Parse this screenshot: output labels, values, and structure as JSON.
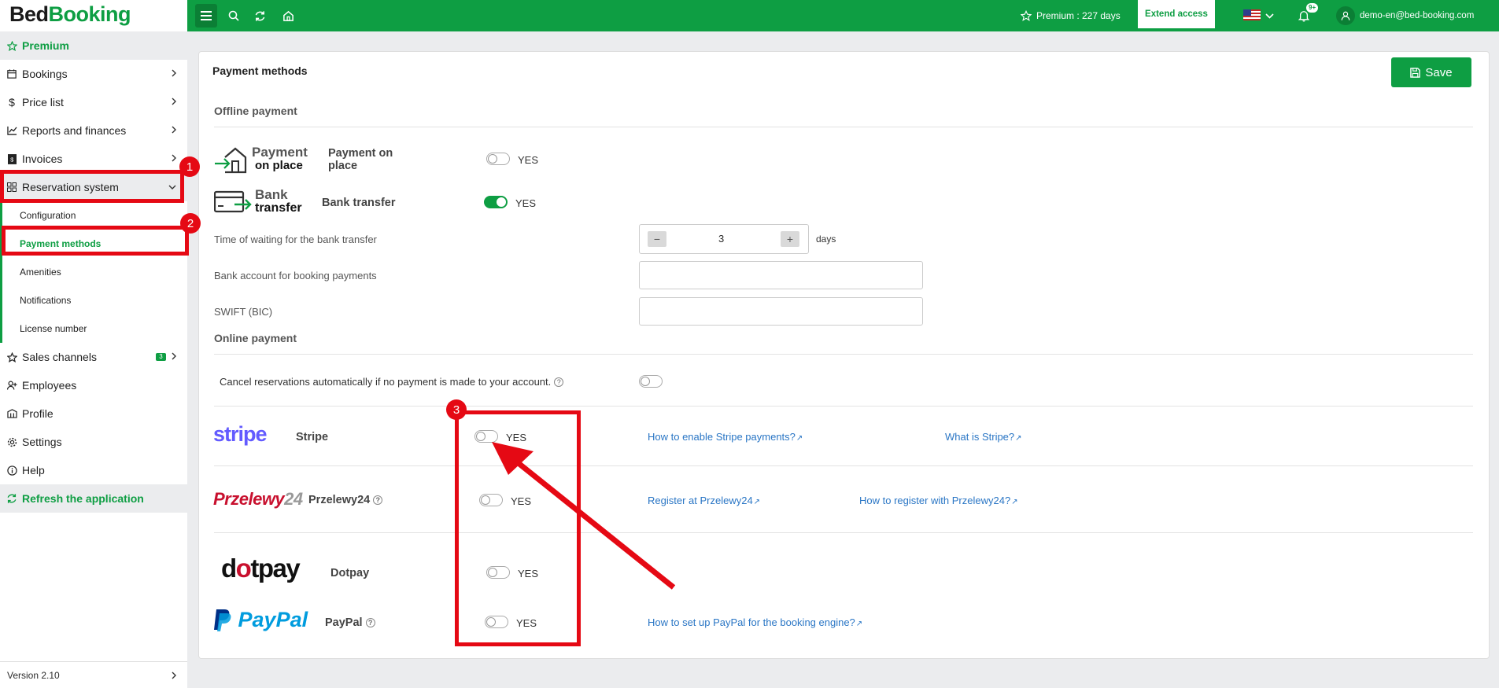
{
  "topbar": {
    "brand_a": "Bed",
    "brand_b": "Booking",
    "premium_text": "Premium : 227 days",
    "extend_label": "Extend access",
    "notifications_badge": "9+",
    "user_email": "demo-en@bed-booking.com"
  },
  "sidebar": {
    "premium": "Premium",
    "bookings": "Bookings",
    "price_list": "Price list",
    "reports": "Reports and finances",
    "invoices": "Invoices",
    "reservation_system": "Reservation system",
    "sub": {
      "configuration": "Configuration",
      "payment_methods": "Payment methods",
      "amenities": "Amenities",
      "notifications": "Notifications",
      "license": "License number"
    },
    "sales_channels": "Sales channels",
    "sales_badge": "3",
    "employees": "Employees",
    "profile": "Profile",
    "settings": "Settings",
    "help": "Help",
    "refresh": "Refresh the application",
    "version": "Version 2.10"
  },
  "main": {
    "title": "Payment methods",
    "save_label": "Save",
    "offline_title": "Offline payment",
    "online_title": "Online payment",
    "place_logo_a": "Payment",
    "place_logo_b": "on place",
    "place_label": "Payment on place",
    "bank_logo_a": "Bank",
    "bank_logo_b": "transfer",
    "bank_label": "Bank transfer",
    "yes": "YES",
    "waiting_label": "Time of waiting for the bank transfer",
    "waiting_value": "3",
    "days": "days",
    "bank_account_label": "Bank account for booking payments",
    "swift_label": "SWIFT (BIC)",
    "cancel_label": "Cancel reservations automatically if no payment is made to your account.",
    "stripe_logo": "stripe",
    "stripe_label": "Stripe",
    "stripe_link1": "How to enable Stripe payments?",
    "stripe_link2": "What is Stripe?",
    "p24_logo_a": "Przelewy",
    "p24_logo_b": "24",
    "p24_label": "Przelewy24",
    "p24_link1": "Register at Przelewy24",
    "p24_link2": "How to register with Przelewy24?",
    "dotpay_logo_a": "d",
    "dotpay_logo_b": "o",
    "dotpay_logo_c": "tpay",
    "dotpay_label": "Dotpay",
    "paypal_logo_a": "Pay",
    "paypal_logo_b": "Pal",
    "paypal_label": "PayPal",
    "paypal_link": "How to set up PayPal for the booking engine?"
  },
  "toggles": {
    "payment_on_place": false,
    "bank_transfer": true,
    "cancel_auto": false,
    "stripe": false,
    "przelewy24": false,
    "dotpay": false,
    "paypal": false
  },
  "annotations": [
    "1",
    "2",
    "3"
  ],
  "colors": {
    "brand_green": "#0e9e43",
    "link_blue": "#2a76c5",
    "annotation_red": "#e50914"
  }
}
